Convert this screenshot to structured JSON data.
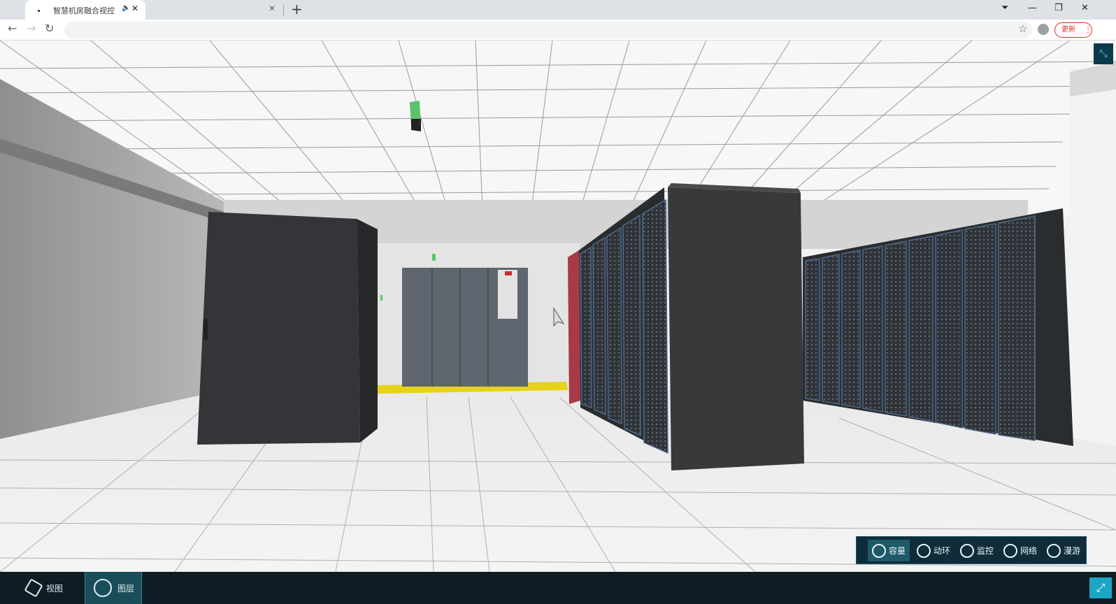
{
  "browser": {
    "tab_title": "智慧机房融合视控",
    "tab_audio_icon": "speaker-icon",
    "new_tab_label": "+",
    "update_label": "更新"
  },
  "scene": {
    "description_colors": {
      "rack": "#3a3a3a",
      "red_rack": "#a83a45",
      "crac_unit": "#5f6670",
      "accent_strip": "#e6d21a",
      "sensor": "#5bc46b"
    }
  },
  "modebar": {
    "items": [
      {
        "label": "容量",
        "icon": "capacity-icon",
        "active": true
      },
      {
        "label": "动环",
        "icon": "environment-icon",
        "active": false
      },
      {
        "label": "监控",
        "icon": "camera-icon",
        "active": false
      },
      {
        "label": "网络",
        "icon": "network-icon",
        "active": false
      },
      {
        "label": "漫游",
        "icon": "roam-icon",
        "active": false
      }
    ]
  },
  "bottombar": {
    "view_label": "视图",
    "layer_label": "图层"
  }
}
